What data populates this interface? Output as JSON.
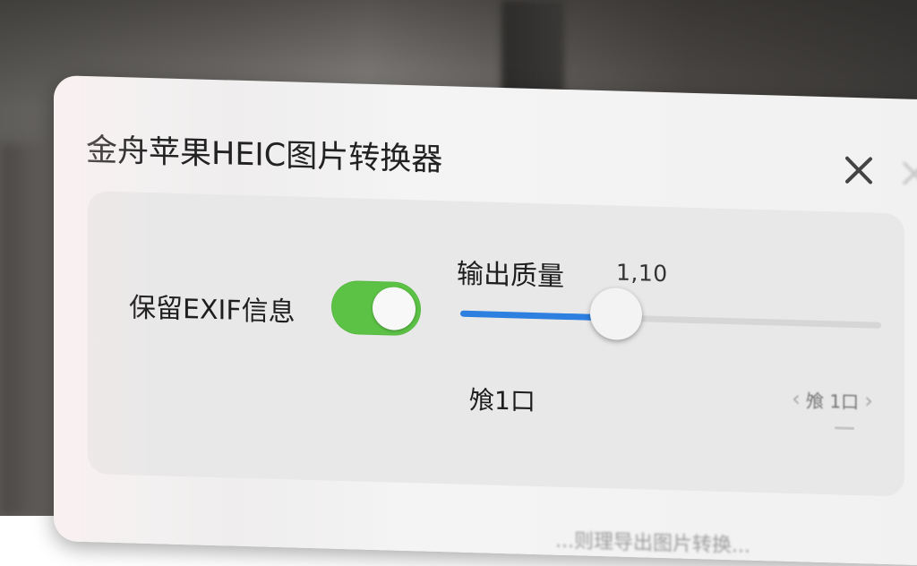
{
  "window": {
    "title": "金舟苹果HEIC图片转换器",
    "close_icon": "close-icon"
  },
  "colors": {
    "toggle_on": "#5cc246",
    "slider_fill": "#2d7fe0",
    "panel_bg": "#e9e8e8"
  },
  "settings": {
    "exif_label": "保留EXIF信息",
    "exif_enabled": true,
    "quality_label": "输出质量",
    "quality_value": "1,10",
    "quality_fraction": 0.37,
    "bottom_label": "飧1口",
    "stepper_value": "飧 1口",
    "stepper_left_icon": "chevron-left-icon",
    "stepper_right_icon": "chevron-right-icon"
  },
  "footer": {
    "hint": "...则理导出图片转换..."
  }
}
